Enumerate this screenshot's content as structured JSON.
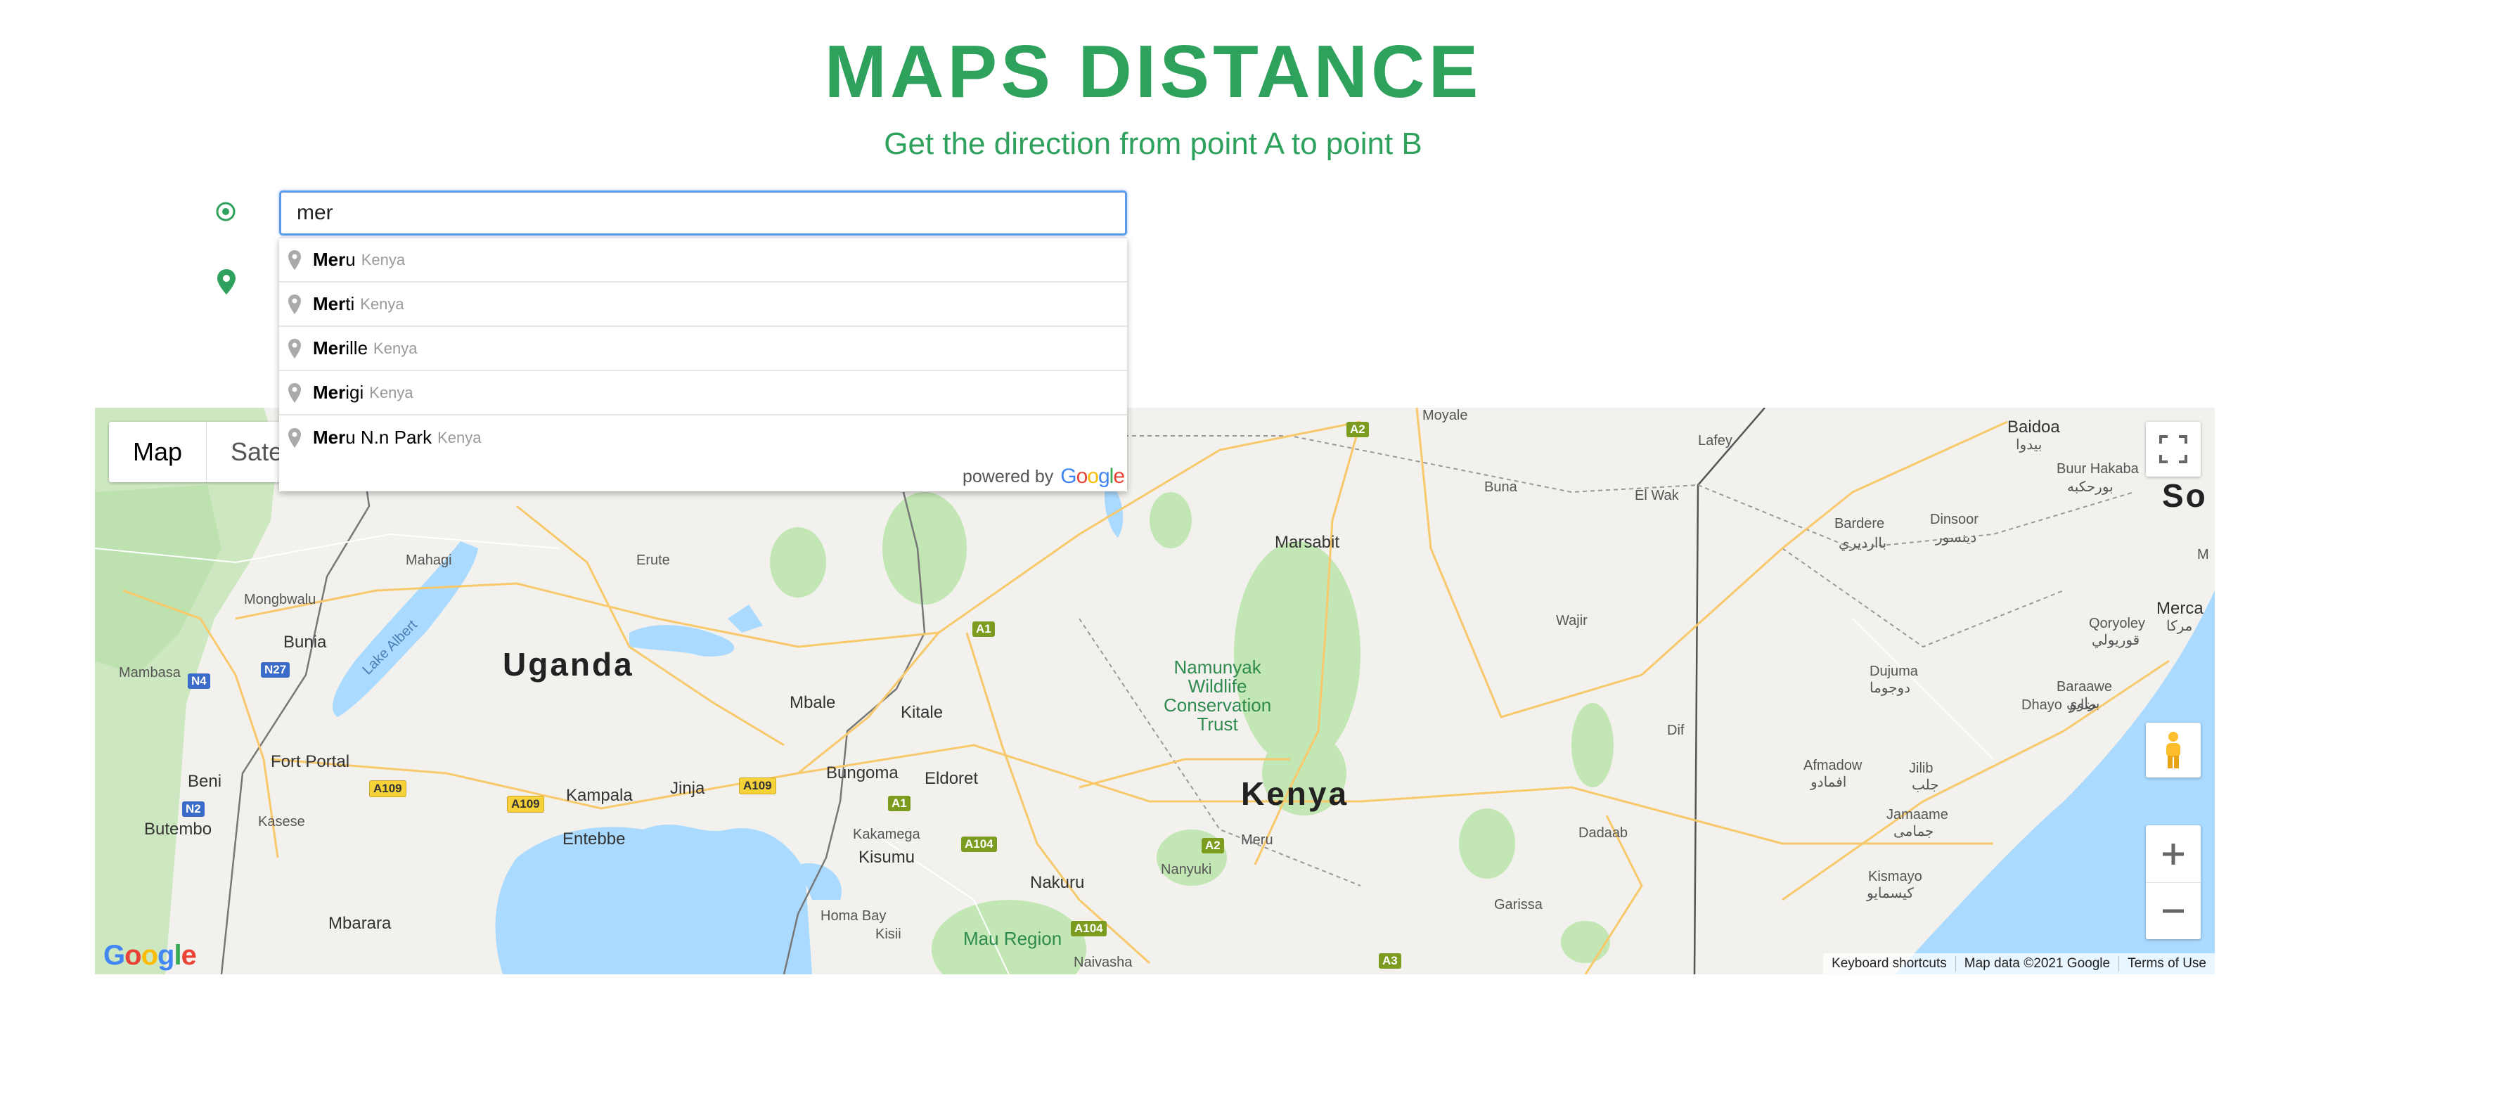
{
  "header": {
    "title": "MAPS DISTANCE",
    "subtitle": "Get the direction from point A to point B"
  },
  "origin": {
    "value": "mer"
  },
  "destination": {
    "value": ""
  },
  "autocomplete": {
    "items": [
      {
        "match": "Mer",
        "rest": "u",
        "country": "Kenya"
      },
      {
        "match": "Mer",
        "rest": "ti",
        "country": "Kenya"
      },
      {
        "match": "Mer",
        "rest": "ille",
        "country": "Kenya"
      },
      {
        "match": "Mer",
        "rest": "igi",
        "country": "Kenya"
      },
      {
        "match": "Mer",
        "rest": "u N.n Park",
        "country": "Kenya"
      }
    ],
    "footer_text": "powered by",
    "footer_brand": "Google"
  },
  "map": {
    "type_buttons": {
      "map": "Map",
      "satellite": "Sate"
    },
    "countries": {
      "uganda": "Uganda",
      "kenya": "Kenya",
      "somalia_partial": "So"
    },
    "cities": {
      "kampala": "Kampala",
      "entebbe": "Entebbe",
      "jinja": "Jinja",
      "mbale": "Mbale",
      "kitale": "Kitale",
      "eldoret": "Eldoret",
      "bungoma": "Bungoma",
      "kakamega": "Kakamega",
      "kisumu": "Kisumu",
      "nakuru": "Nakuru",
      "nanyuki": "Nanyuki",
      "meru": "Meru",
      "marsabit": "Marsabit",
      "garissa": "Garissa",
      "wajir": "Wajir",
      "dadaab": "Dadaab",
      "fort_portal": "Fort Portal",
      "beni": "Beni",
      "butembo": "Butembo",
      "kasese": "Kasese",
      "mbarara": "Mbarara",
      "bunia": "Bunia",
      "mahagi": "Mahagi",
      "mongbwalu": "Mongbwalu",
      "mambasa": "Mambasa",
      "homa_bay": "Homa Bay",
      "kisii": "Kisii",
      "naivasha": "Naivasha",
      "moyale": "Moyale",
      "buna": "Buna",
      "el_wak": "El Wak",
      "lafey": "Lafey",
      "baidoa": "Baidoa",
      "baidoa_ar": "بيدوا",
      "buur_hakaba": "Buur Hakaba",
      "buur_hakaba_ar": "بورحكبه",
      "bardere": "Bardere",
      "bardere_ar": "باارديري",
      "dinsoor": "Dinsoor",
      "dinsoor_ar": "دينسور",
      "qoryoley": "Qoryoley",
      "qoryoley_ar": "قوريولي",
      "merca": "Merca",
      "merca_ar": "مركا",
      "dujuma": "Dujuma",
      "dujuma_ar": "دوجوما",
      "dhayo": "Dhayo",
      "dhayo_ar": "ضايو",
      "baraawe": "Baraawe",
      "baraawe_ar": "براوي",
      "afmadow": "Afmadow",
      "afmadow_ar": "افمادو",
      "jilib": "Jilib",
      "jilib_ar": "جلب",
      "jamaame": "Jamaame",
      "jamaame_ar": "جمامى",
      "kismayo": "Kismayo",
      "kismayo_ar": "كيسمايو",
      "dif": "Dif",
      "erute": "Erute",
      "m": "M",
      "lake_albert": "Lake Albert"
    },
    "parks": {
      "namunyak": "Namunyak\nWildlife\nConservation\nTrust",
      "mau": "Mau Region"
    },
    "roads": [
      "A2",
      "A1",
      "A104",
      "A109",
      "A109",
      "A109",
      "A1",
      "A2",
      "A104",
      "A3",
      "N27",
      "N4",
      "N2"
    ],
    "attribution": {
      "shortcuts": "Keyboard shortcuts",
      "data": "Map data ©2021 Google",
      "terms": "Terms of Use"
    },
    "logo": "Google"
  },
  "colors": {
    "accent": "#2ea15d",
    "water": "#aadaff",
    "park": "#c3e6b5",
    "land": "#f2f1ed",
    "road": "#f7c96b"
  }
}
